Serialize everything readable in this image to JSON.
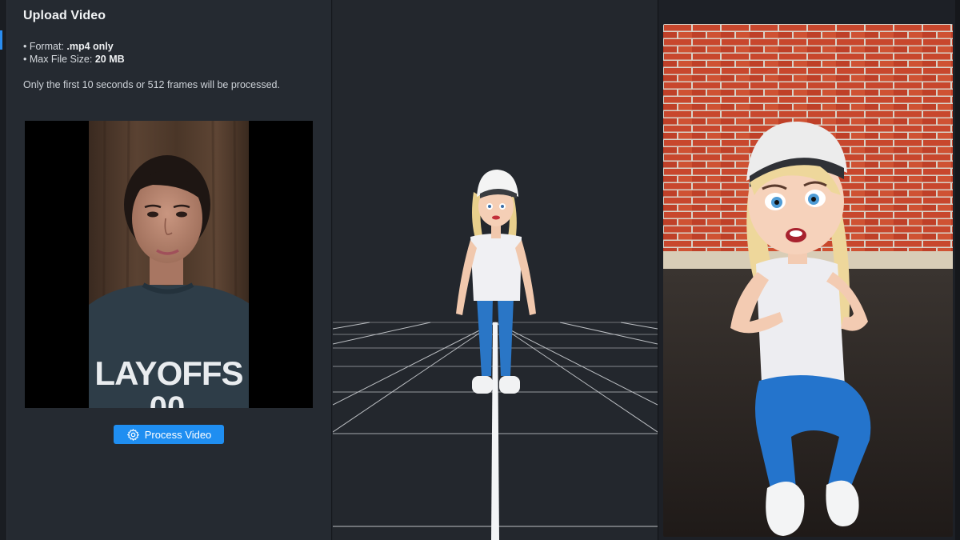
{
  "upload": {
    "title": "Upload Video",
    "requirements": [
      {
        "label": "• Format: ",
        "value": ".mp4 only"
      },
      {
        "label": "• Max File Size: ",
        "value": "20 MB"
      }
    ],
    "note": "Only the first 10 seconds or 512 frames will be processed.",
    "preview_shirt_text": "LAYOFFS",
    "process_button_label": "Process Video",
    "process_button_icon": "gear-icon"
  },
  "colors": {
    "accent": "#1f8ef1",
    "panel_bg": "#252a31",
    "viewport_bg": "#23272d",
    "brick": "#c4452c"
  }
}
